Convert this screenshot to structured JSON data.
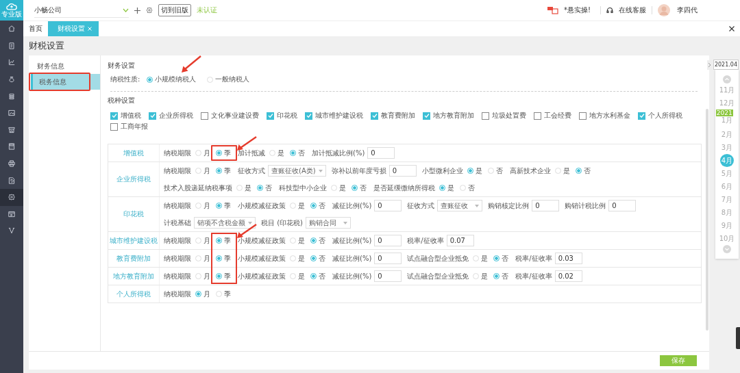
{
  "app": {
    "logo_label": "专业版",
    "company": "小畅公司",
    "switch_button": "切到旧版",
    "auth_status": "未认证",
    "promo": "*悬实操!",
    "support": "在线客服",
    "user": "李四代"
  },
  "nav": [
    {
      "selected": false
    },
    {
      "selected": false
    },
    {
      "selected": false
    },
    {
      "selected": false
    },
    {
      "selected": false
    },
    {
      "selected": false
    },
    {
      "selected": false
    },
    {
      "selected": false
    },
    {
      "selected": false
    },
    {
      "selected": false
    },
    {
      "selected": true
    },
    {
      "selected": false
    },
    {
      "selected": false
    }
  ],
  "tabs": [
    {
      "label": "首页",
      "selected": false,
      "closable": false
    },
    {
      "label": "财税设置",
      "selected": true,
      "closable": true
    }
  ],
  "page_title": "财税设置",
  "side_menu": [
    {
      "label": "财务信息",
      "selected": false,
      "boxed": false
    },
    {
      "label": "税务信息",
      "selected": true,
      "boxed": true
    }
  ],
  "finance": {
    "heading": "财务设置",
    "label": "纳税性质:",
    "options": [
      {
        "label": "小规模纳税人",
        "selected": true,
        "arrow": true
      },
      {
        "label": "一般纳税人",
        "selected": false,
        "arrow": false
      }
    ]
  },
  "tax_types": {
    "heading": "税种设置",
    "items": [
      {
        "label": "增值税",
        "checked": true
      },
      {
        "label": "企业所得税",
        "checked": true
      },
      {
        "label": "文化事业建设费",
        "checked": false
      },
      {
        "label": "印花税",
        "checked": true
      },
      {
        "label": "城市维护建设税",
        "checked": true
      },
      {
        "label": "教育费附加",
        "checked": true
      },
      {
        "label": "地方教育附加",
        "checked": true
      },
      {
        "label": "垃圾处置费",
        "checked": false
      },
      {
        "label": "工会经费",
        "checked": false
      },
      {
        "label": "地方水利基金",
        "checked": false
      },
      {
        "label": "个人所得税",
        "checked": true
      },
      {
        "label": "工商年报",
        "checked": false
      }
    ]
  },
  "tax_table": [
    {
      "name": "增值税",
      "lines": [
        {
          "items": [
            {
              "kind": "radio",
              "label": "纳税期限",
              "options": [
                {
                  "label": "月",
                  "selected": false
                },
                {
                  "label": "季",
                  "selected": true,
                  "boxed": true,
                  "arrow": true
                }
              ]
            },
            {
              "kind": "radio",
              "label": "加计抵减",
              "options": [
                {
                  "label": "是",
                  "selected": false
                },
                {
                  "label": "否",
                  "selected": true
                }
              ]
            },
            {
              "kind": "input",
              "label": "加计抵减比例(%)",
              "value": "0"
            }
          ]
        }
      ]
    },
    {
      "name": "企业所得税",
      "lines": [
        {
          "items": [
            {
              "kind": "radio",
              "label": "纳税期限",
              "options": [
                {
                  "label": "月",
                  "selected": false
                },
                {
                  "label": "季",
                  "selected": true
                }
              ]
            },
            {
              "kind": "select",
              "label": "征收方式",
              "value": "查账征收(A类)"
            },
            {
              "kind": "input",
              "label": "弥补以前年度亏损",
              "value": "0"
            },
            {
              "kind": "radio",
              "label": "小型微利企业",
              "options": [
                {
                  "label": "是",
                  "selected": true
                },
                {
                  "label": "否",
                  "selected": false
                }
              ]
            },
            {
              "kind": "radio",
              "label": "高新技术企业",
              "options": [
                {
                  "label": "是",
                  "selected": false
                },
                {
                  "label": "否",
                  "selected": true
                }
              ]
            }
          ]
        },
        {
          "items": [
            {
              "kind": "radio",
              "label": "技术入股递延纳税事项",
              "options": [
                {
                  "label": "是",
                  "selected": false
                },
                {
                  "label": "否",
                  "selected": true
                }
              ]
            },
            {
              "kind": "radio",
              "label": "科技型中小企业",
              "options": [
                {
                  "label": "是",
                  "selected": false
                },
                {
                  "label": "否",
                  "selected": true
                }
              ]
            },
            {
              "kind": "radio",
              "label": "是否延缓缴纳所得税",
              "options": [
                {
                  "label": "是",
                  "selected": true
                },
                {
                  "label": "否",
                  "selected": false
                }
              ]
            }
          ]
        }
      ]
    },
    {
      "name": "印花税",
      "lines": [
        {
          "items": [
            {
              "kind": "radio",
              "label": "纳税期限",
              "options": [
                {
                  "label": "月",
                  "selected": false
                },
                {
                  "label": "季",
                  "selected": true
                }
              ]
            },
            {
              "kind": "radio",
              "label": "小规模减征政策",
              "options": [
                {
                  "label": "是",
                  "selected": false
                },
                {
                  "label": "否",
                  "selected": true
                }
              ]
            },
            {
              "kind": "input",
              "label": "减征比例(%)",
              "value": "0"
            },
            {
              "kind": "select",
              "label": "征收方式",
              "value": "查账征收"
            },
            {
              "kind": "input",
              "label": "购销核定比例",
              "value": "0"
            },
            {
              "kind": "input",
              "label": "购销计税比例",
              "value": "0"
            }
          ]
        },
        {
          "items": [
            {
              "kind": "select",
              "label": "计税基础",
              "value": "销项不含税金额"
            },
            {
              "kind": "select",
              "label": "税目 (印花税)",
              "value": "购销合同"
            }
          ]
        }
      ]
    },
    {
      "name": "城市维护建设税",
      "lines": [
        {
          "items": [
            {
              "kind": "radio",
              "label": "纳税期限",
              "options": [
                {
                  "label": "月",
                  "selected": false
                },
                {
                  "label": "季",
                  "selected": true,
                  "boxed": true,
                  "arrow": true
                }
              ]
            },
            {
              "kind": "radio",
              "label": "小规模减征政策",
              "options": [
                {
                  "label": "是",
                  "selected": false
                },
                {
                  "label": "否",
                  "selected": true
                }
              ]
            },
            {
              "kind": "input",
              "label": "减征比例(%)",
              "value": "0"
            },
            {
              "kind": "input",
              "label": "税率/征收率",
              "value": "0.07"
            }
          ]
        }
      ]
    },
    {
      "name": "教育费附加",
      "lines": [
        {
          "items": [
            {
              "kind": "radio",
              "label": "纳税期限",
              "options": [
                {
                  "label": "月",
                  "selected": false
                },
                {
                  "label": "季",
                  "selected": true,
                  "boxed": true
                }
              ]
            },
            {
              "kind": "radio",
              "label": "小规模减征政策",
              "options": [
                {
                  "label": "是",
                  "selected": false
                },
                {
                  "label": "否",
                  "selected": true
                }
              ]
            },
            {
              "kind": "input",
              "label": "减征比例(%)",
              "value": "0"
            },
            {
              "kind": "radio",
              "label": "试点融合型企业抵免",
              "options": [
                {
                  "label": "是",
                  "selected": false
                },
                {
                  "label": "否",
                  "selected": true
                }
              ]
            },
            {
              "kind": "input",
              "label": "税率/征收率",
              "value": "0.03"
            }
          ]
        }
      ]
    },
    {
      "name": "地方教育附加",
      "lines": [
        {
          "items": [
            {
              "kind": "radio",
              "label": "纳税期限",
              "options": [
                {
                  "label": "月",
                  "selected": false
                },
                {
                  "label": "季",
                  "selected": true,
                  "boxed": true
                }
              ]
            },
            {
              "kind": "radio",
              "label": "小规模减征政策",
              "options": [
                {
                  "label": "是",
                  "selected": false
                },
                {
                  "label": "否",
                  "selected": true
                }
              ]
            },
            {
              "kind": "input",
              "label": "减征比例(%)",
              "value": "0"
            },
            {
              "kind": "radio",
              "label": "试点融合型企业抵免",
              "options": [
                {
                  "label": "是",
                  "selected": false
                },
                {
                  "label": "否",
                  "selected": true
                }
              ]
            },
            {
              "kind": "input",
              "label": "税率/征收率",
              "value": "0.02"
            }
          ]
        }
      ]
    },
    {
      "name": "个人所得税",
      "lines": [
        {
          "items": [
            {
              "kind": "radio",
              "label": "纳税期限",
              "options": [
                {
                  "label": "月",
                  "selected": true
                },
                {
                  "label": "季",
                  "selected": false
                }
              ]
            }
          ]
        }
      ]
    }
  ],
  "timeline": {
    "current": "2021.04",
    "months": [
      {
        "label": "11月",
        "selected": false
      },
      {
        "label": "12月",
        "selected": false
      },
      {
        "label": "1月",
        "selected": false,
        "year": "2021"
      },
      {
        "label": "2月",
        "selected": false
      },
      {
        "label": "3月",
        "selected": false
      },
      {
        "label": "4月",
        "selected": true
      },
      {
        "label": "5月",
        "selected": false
      },
      {
        "label": "6月",
        "selected": false
      },
      {
        "label": "7月",
        "selected": false
      },
      {
        "label": "8月",
        "selected": false
      },
      {
        "label": "9月",
        "selected": false
      },
      {
        "label": "10月",
        "selected": false
      }
    ]
  },
  "save_button": "保存"
}
